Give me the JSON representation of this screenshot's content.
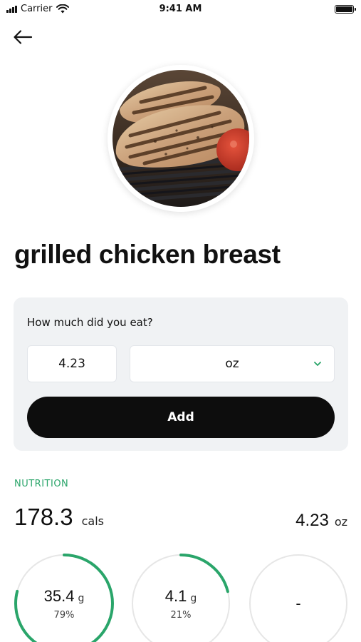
{
  "status_bar": {
    "carrier": "Carrier",
    "time": "9:41 AM",
    "signal_icon": "signal-bars-icon",
    "wifi_icon": "wifi-icon",
    "battery_icon": "battery-icon"
  },
  "header": {
    "back_icon": "arrow-left-icon"
  },
  "food": {
    "title": "grilled chicken breast",
    "photo": "grilled-chicken-photo"
  },
  "portion": {
    "question": "How much did you eat?",
    "quantity_value": "4.23",
    "unit_value": "oz",
    "dropdown_icon": "chevron-down-icon",
    "add_label": "Add"
  },
  "nutrition": {
    "section_label": "NUTRITION",
    "calories": "178.3",
    "calories_unit": "cals",
    "serving_amount": "4.23",
    "serving_unit": "oz",
    "macros": [
      {
        "value": "35.4",
        "unit": "g",
        "percent": "79%",
        "fraction": 0.79
      },
      {
        "value": "4.1",
        "unit": "g",
        "percent": "21%",
        "fraction": 0.21
      },
      {
        "value": "-",
        "fraction": 0
      }
    ]
  },
  "colors": {
    "accent_green": "#2aa56a",
    "ring_track": "#e6e6e6",
    "button_dark": "#0d0d0d",
    "card_background": "#f0f2f4"
  }
}
